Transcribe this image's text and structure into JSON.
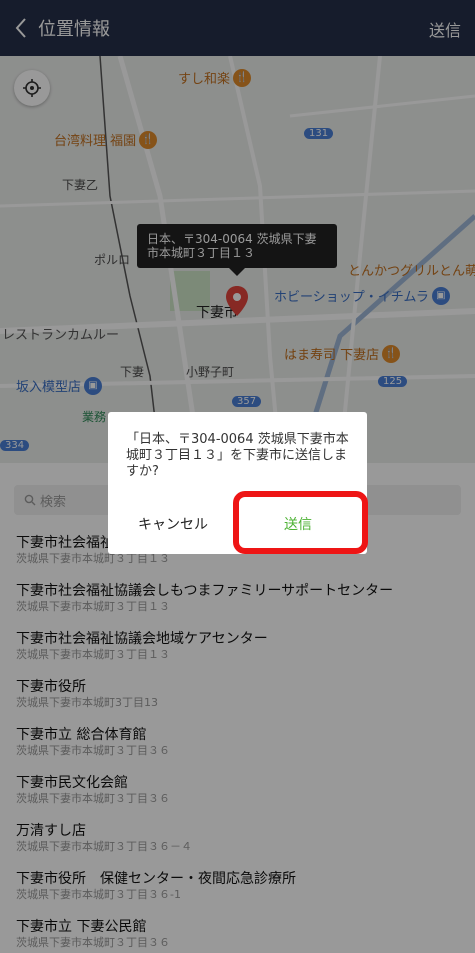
{
  "header": {
    "title": "位置情報",
    "send_label": "送信"
  },
  "map": {
    "pois": {
      "sushi": "すし和楽",
      "taiwan": "台湾料理 福園",
      "tonkatsu": "とんかつグリルとん萌",
      "hobby": "ホビーショップ・イチムラ",
      "hamazushi": "はま寿司 下妻店",
      "restaurant": "レストランカムルー",
      "mokei": "坂入模型店"
    },
    "streets": {
      "shimotsuma_otsu": "下妻乙",
      "porokku": "ポルロ",
      "shimotsuma_city": "下妻市",
      "onoko": "小野子町",
      "shimotsuma_station": "下妻",
      "gyomu": "業務"
    },
    "routes": {
      "r131": "131",
      "r357": "357",
      "r125": "125",
      "r334": "334"
    },
    "tooltip": "日本、〒304-0064 茨城県下妻市本城町３丁目１３"
  },
  "search": {
    "placeholder": "検索"
  },
  "list": [
    {
      "name": "下妻市社会福祉協議会",
      "addr": "茨城県下妻市本城町３丁目１３"
    },
    {
      "name": "下妻市社会福祉協議会しもつまファミリーサポートセンター",
      "addr": "茨城県下妻市本城町３丁目１３"
    },
    {
      "name": "下妻市社会福祉協議会地域ケアセンター",
      "addr": "茨城県下妻市本城町３丁目１３"
    },
    {
      "name": "下妻市役所",
      "addr": "茨城県下妻市本城町3丁目13"
    },
    {
      "name": "下妻市立 総合体育館",
      "addr": "茨城県下妻市本城町３丁目３６"
    },
    {
      "name": "下妻市民文化会館",
      "addr": "茨城県下妻市本城町３丁目３６"
    },
    {
      "name": "万清すし店",
      "addr": "茨城県下妻市本城町３丁目３６－４"
    },
    {
      "name": "下妻市役所　保健センター・夜間応急診療所",
      "addr": "茨城県下妻市本城町３丁目３６-1"
    },
    {
      "name": "下妻市立 下妻公民館",
      "addr": "茨城県下妻市本城町３丁目３６"
    }
  ],
  "dialog": {
    "message": "「日本、〒304-0064 茨城県下妻市本城町３丁目１３」を下妻市に送信しますか?",
    "cancel_label": "キャンセル",
    "ok_label": "送信"
  },
  "colors": {
    "header_bg": "#25304a",
    "accent_green": "#4cb233",
    "highlight_red": "#ee1515"
  }
}
